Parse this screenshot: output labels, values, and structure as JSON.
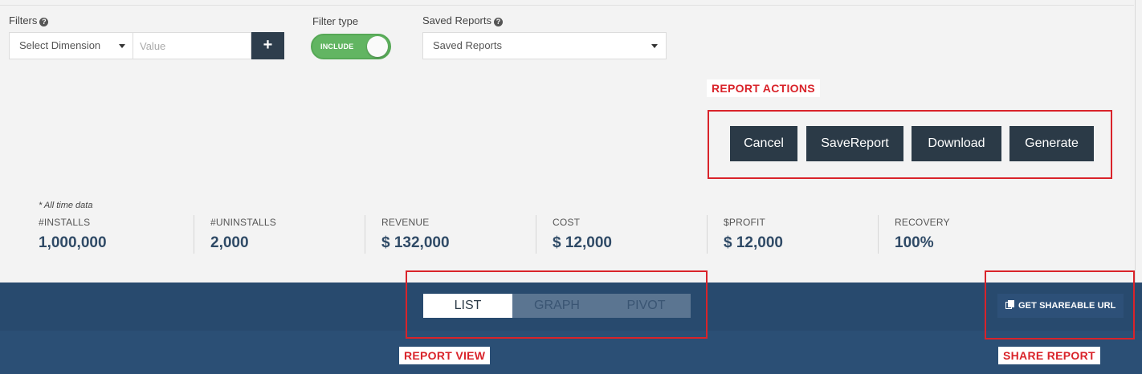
{
  "filters": {
    "label": "Filters",
    "dimension_placeholder": "Select Dimension",
    "value_placeholder": "Value",
    "add_label": "+"
  },
  "filter_type": {
    "label": "Filter type",
    "state": "INCLUDE"
  },
  "saved_reports": {
    "label": "Saved Reports",
    "selected": "Saved Reports"
  },
  "annotations": {
    "report_actions": "REPORT ACTIONS",
    "report_view": "REPORT VIEW",
    "share_report": "SHARE REPORT"
  },
  "actions": {
    "cancel": "Cancel",
    "save": "SaveReport",
    "download": "Download",
    "generate": "Generate"
  },
  "metrics": {
    "note": "* All time data",
    "items": [
      {
        "label": "#INSTALLS",
        "value": "1,000,000"
      },
      {
        "label": "#UNINSTALLS",
        "value": "2,000"
      },
      {
        "label": "REVENUE",
        "value": "$ 132,000"
      },
      {
        "label": "COST",
        "value": "$ 12,000"
      },
      {
        "label": "$PROFIT",
        "value": "$ 12,000"
      },
      {
        "label": "RECOVERY",
        "value": "100%"
      }
    ]
  },
  "view_tabs": {
    "list": "LIST",
    "graph": "GRAPH",
    "pivot": "PIVOT",
    "active": "LIST"
  },
  "share": {
    "label": "GET SHAREABLE URL"
  },
  "colors": {
    "accent_dark": "#2b3a47",
    "band_blue": "#284a6e",
    "toggle_green": "#62b562",
    "annotation_red": "#d9232a",
    "metric_value": "#2f4a66"
  }
}
